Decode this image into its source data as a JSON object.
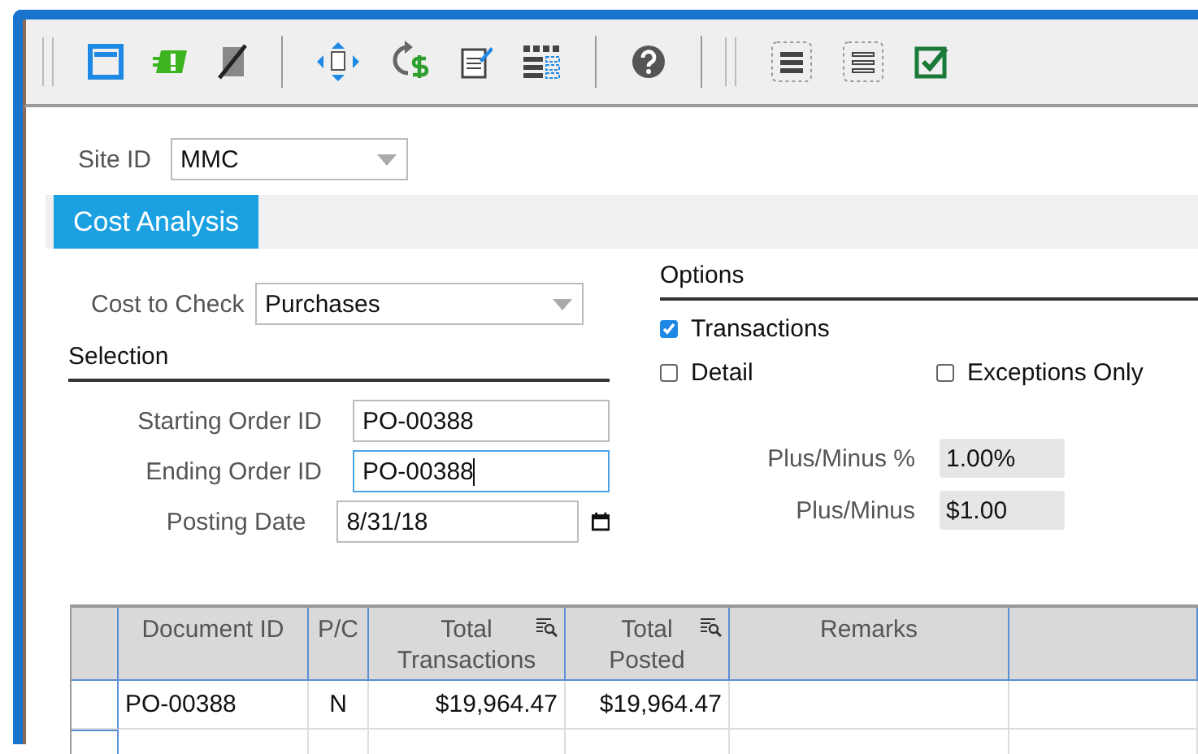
{
  "site": {
    "label": "Site ID",
    "value": "MMC"
  },
  "tabs": [
    {
      "label": "Cost Analysis",
      "selected": true
    }
  ],
  "cost_to_check": {
    "label": "Cost to Check",
    "value": "Purchases"
  },
  "selection": {
    "heading": "Selection",
    "fields": [
      {
        "label": "Starting Order ID",
        "value": "PO-00388",
        "focused": false,
        "kind": "text"
      },
      {
        "label": "Ending Order ID",
        "value": "PO-00388",
        "focused": true,
        "kind": "text"
      },
      {
        "label": "Posting Date",
        "value": "8/31/18",
        "focused": false,
        "kind": "date"
      }
    ]
  },
  "options": {
    "heading": "Options",
    "checkboxes": [
      {
        "label": "Transactions",
        "checked": true
      },
      {
        "label": "Detail",
        "checked": false
      },
      {
        "label": "Exceptions Only",
        "checked": false
      }
    ],
    "tolerances": [
      {
        "label": "Plus/Minus %",
        "value": "1.00%"
      },
      {
        "label": "Plus/Minus",
        "value": "$1.00"
      }
    ]
  },
  "table": {
    "columns": [
      {
        "label": "Document ID",
        "kind": "text",
        "filterable": false
      },
      {
        "label": "P/C",
        "kind": "flag",
        "filterable": false
      },
      {
        "label": "Total Transactions",
        "kind": "amount",
        "filterable": true
      },
      {
        "label": "Total Posted",
        "kind": "amount",
        "filterable": true
      },
      {
        "label": "Remarks",
        "kind": "text",
        "filterable": false
      }
    ],
    "rows": [
      {
        "cells": [
          "PO-00388",
          "N",
          "$19,964.47",
          "$19,964.47"
        ]
      }
    ]
  }
}
